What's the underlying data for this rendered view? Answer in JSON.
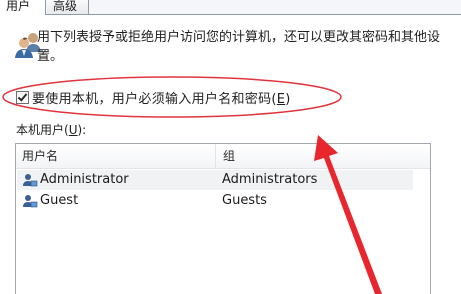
{
  "tabs": [
    {
      "label": "用户"
    },
    {
      "label": "高级"
    }
  ],
  "description": "用下列表授予或拒绝用户访问您的计算机，还可以更改其密码和其他设置。",
  "require_password": {
    "label": "要使用本机，用户必须输入用户名和密码(",
    "mnemonic": "E",
    "label_suffix": ")",
    "checked": true
  },
  "users_list": {
    "label_prefix": "本机用户(",
    "mnemonic": "U",
    "label_suffix": "):",
    "columns": [
      "用户名",
      "组"
    ],
    "rows": [
      {
        "user": "Administrator",
        "group": "Administrators",
        "icon": "user-account-icon"
      },
      {
        "user": "Guest",
        "group": "Guests",
        "icon": "user-account-icon"
      }
    ]
  },
  "annotation_colors": {
    "ellipse": "#e0353d",
    "arrow": "#e8262d"
  }
}
